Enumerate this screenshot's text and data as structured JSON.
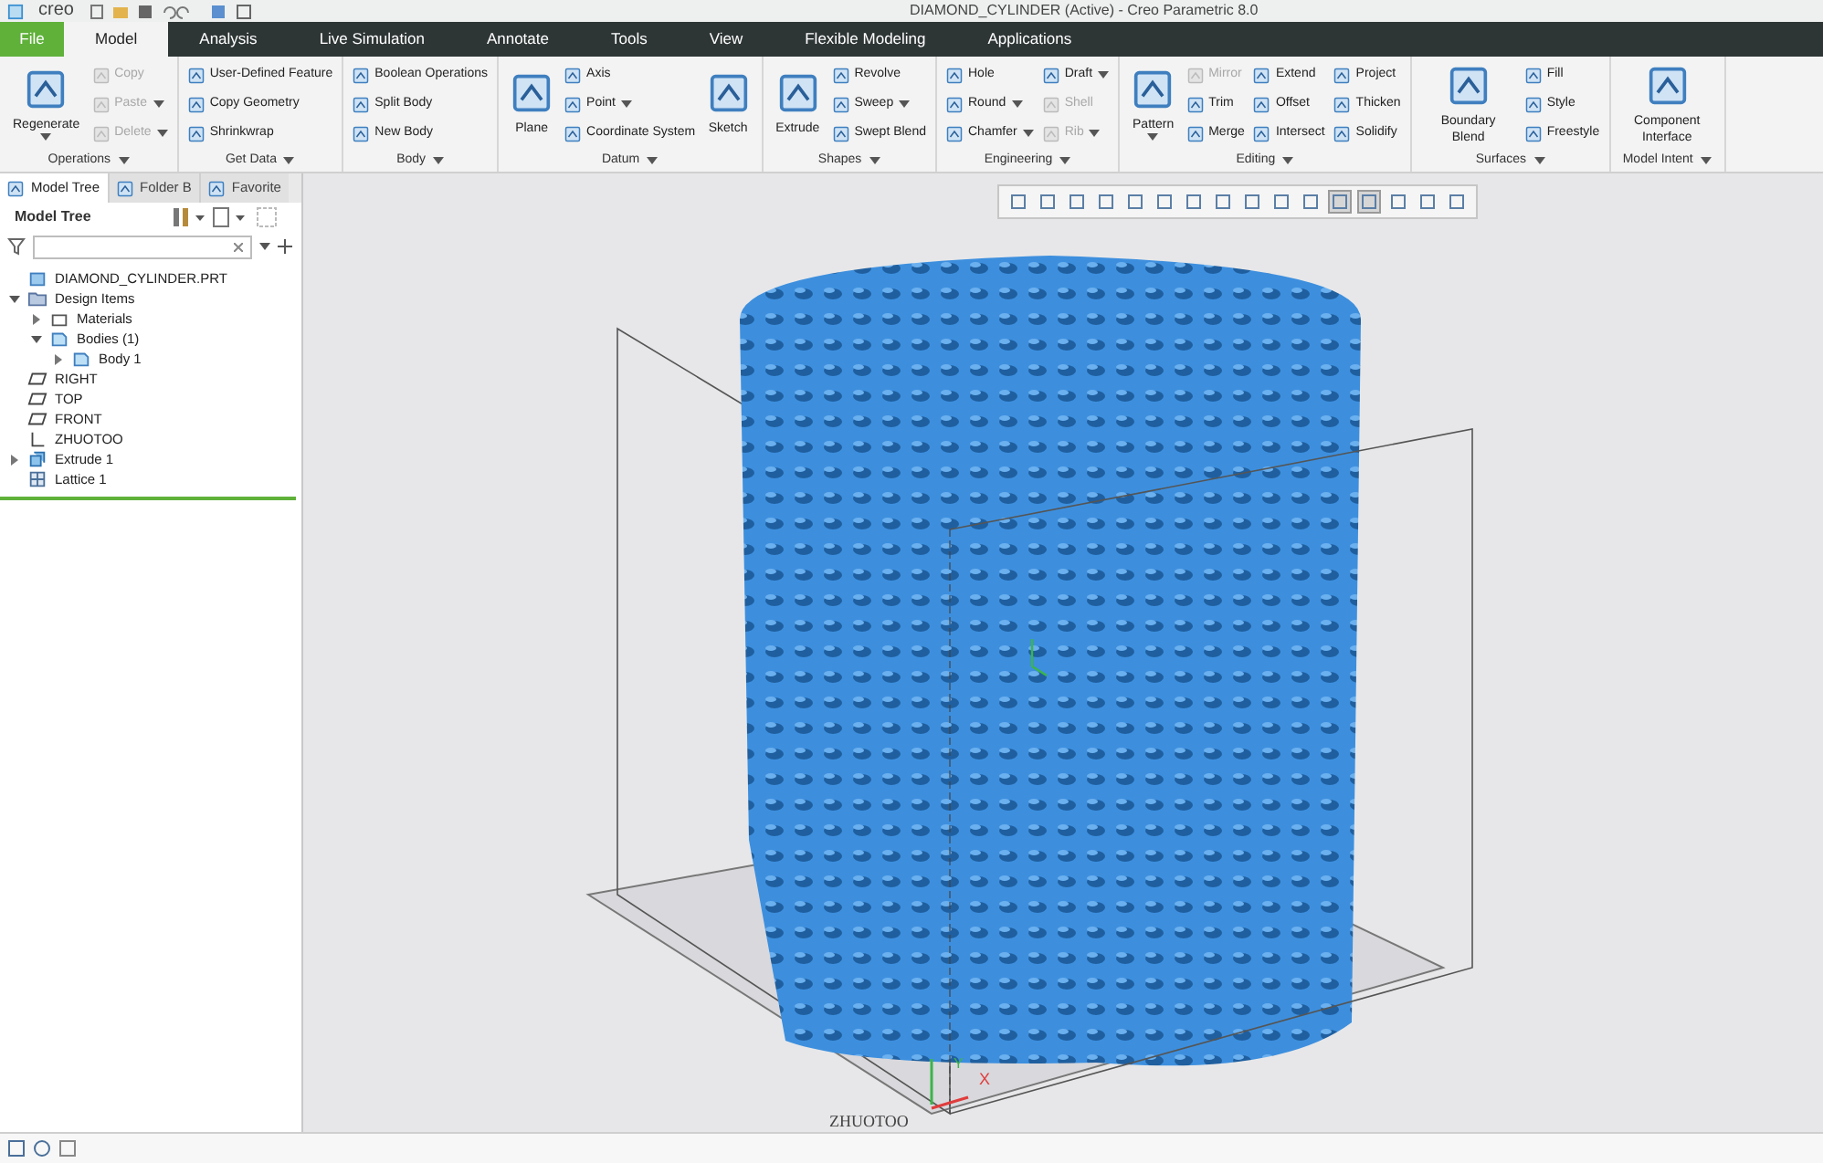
{
  "title_bar": {
    "logo": "creo",
    "title": "DIAMOND_CYLINDER (Active) - Creo Parametric 8.0"
  },
  "tabs": [
    {
      "label": "File",
      "kind": "file",
      "selected": false
    },
    {
      "label": "Model",
      "kind": "tab",
      "selected": true
    },
    {
      "label": "Analysis",
      "kind": "tab",
      "selected": false
    },
    {
      "label": "Live Simulation",
      "kind": "tab",
      "selected": false
    },
    {
      "label": "Annotate",
      "kind": "tab",
      "selected": false
    },
    {
      "label": "Tools",
      "kind": "tab",
      "selected": false
    },
    {
      "label": "View",
      "kind": "tab",
      "selected": false
    },
    {
      "label": "Flexible Modeling",
      "kind": "tab",
      "selected": false
    },
    {
      "label": "Applications",
      "kind": "tab",
      "selected": false
    }
  ],
  "ribbon_groups": [
    {
      "label": "Operations",
      "columns": [
        [
          {
            "label": "Regenerate",
            "kind": "large",
            "disabled": false,
            "dropdown": true
          }
        ],
        [
          {
            "label": "Copy",
            "kind": "small",
            "disabled": true,
            "dropdown": false
          },
          {
            "label": "Paste",
            "kind": "small",
            "disabled": true,
            "dropdown": true
          },
          {
            "label": "Delete",
            "kind": "small",
            "disabled": true,
            "dropdown": true
          }
        ]
      ]
    },
    {
      "label": "Get Data",
      "columns": [
        [
          {
            "label": "User-Defined Feature",
            "kind": "small",
            "disabled": false,
            "dropdown": false
          },
          {
            "label": "Copy Geometry",
            "kind": "small",
            "disabled": false,
            "dropdown": false
          },
          {
            "label": "Shrinkwrap",
            "kind": "small",
            "disabled": false,
            "dropdown": false
          }
        ]
      ]
    },
    {
      "label": "Body",
      "columns": [
        [
          {
            "label": "Boolean Operations",
            "kind": "small",
            "disabled": false,
            "dropdown": false
          },
          {
            "label": "Split Body",
            "kind": "small",
            "disabled": false,
            "dropdown": false
          },
          {
            "label": "New Body",
            "kind": "small",
            "disabled": false,
            "dropdown": false
          }
        ]
      ]
    },
    {
      "label": "Datum",
      "columns": [
        [
          {
            "label": "Plane",
            "kind": "large",
            "disabled": false,
            "dropdown": false
          }
        ],
        [
          {
            "label": "Axis",
            "kind": "small",
            "disabled": false,
            "dropdown": false
          },
          {
            "label": "Point",
            "kind": "small",
            "disabled": false,
            "dropdown": true
          },
          {
            "label": "Coordinate System",
            "kind": "small",
            "disabled": false,
            "dropdown": false
          }
        ],
        [
          {
            "label": "Sketch",
            "kind": "large",
            "disabled": false,
            "dropdown": false
          }
        ]
      ]
    },
    {
      "label": "Shapes",
      "columns": [
        [
          {
            "label": "Extrude",
            "kind": "large",
            "disabled": false,
            "dropdown": false
          }
        ],
        [
          {
            "label": "Revolve",
            "kind": "small",
            "disabled": false,
            "dropdown": false
          },
          {
            "label": "Sweep",
            "kind": "small",
            "disabled": false,
            "dropdown": true
          },
          {
            "label": "Swept Blend",
            "kind": "small",
            "disabled": false,
            "dropdown": false
          }
        ]
      ]
    },
    {
      "label": "Engineering",
      "columns": [
        [
          {
            "label": "Hole",
            "kind": "small",
            "disabled": false,
            "dropdown": false
          },
          {
            "label": "Round",
            "kind": "small",
            "disabled": false,
            "dropdown": true
          },
          {
            "label": "Chamfer",
            "kind": "small",
            "disabled": false,
            "dropdown": true
          }
        ],
        [
          {
            "label": "Draft",
            "kind": "small",
            "disabled": false,
            "dropdown": true
          },
          {
            "label": "Shell",
            "kind": "small",
            "disabled": true,
            "dropdown": false
          },
          {
            "label": "Rib",
            "kind": "small",
            "disabled": true,
            "dropdown": true
          }
        ]
      ]
    },
    {
      "label": "Editing",
      "columns": [
        [
          {
            "label": "Pattern",
            "kind": "large",
            "disabled": false,
            "dropdown": true
          }
        ],
        [
          {
            "label": "Mirror",
            "kind": "small",
            "disabled": true,
            "dropdown": false
          },
          {
            "label": "Trim",
            "kind": "small",
            "disabled": false,
            "dropdown": false
          },
          {
            "label": "Merge",
            "kind": "small",
            "disabled": false,
            "dropdown": false
          }
        ],
        [
          {
            "label": "Extend",
            "kind": "small",
            "disabled": false,
            "dropdown": false
          },
          {
            "label": "Offset",
            "kind": "small",
            "disabled": false,
            "dropdown": false
          },
          {
            "label": "Intersect",
            "kind": "small",
            "disabled": false,
            "dropdown": false
          }
        ],
        [
          {
            "label": "Project",
            "kind": "small",
            "disabled": false,
            "dropdown": false
          },
          {
            "label": "Thicken",
            "kind": "small",
            "disabled": false,
            "dropdown": false
          },
          {
            "label": "Solidify",
            "kind": "small",
            "disabled": false,
            "dropdown": false
          }
        ]
      ]
    },
    {
      "label": "Surfaces",
      "columns": [
        [
          {
            "label": "Boundary Blend",
            "kind": "large",
            "disabled": false,
            "dropdown": false
          }
        ],
        [
          {
            "label": "Fill",
            "kind": "small",
            "disabled": false,
            "dropdown": false
          },
          {
            "label": "Style",
            "kind": "small",
            "disabled": false,
            "dropdown": false
          },
          {
            "label": "Freestyle",
            "kind": "small",
            "disabled": false,
            "dropdown": false
          }
        ]
      ]
    },
    {
      "label": "Model Intent",
      "columns": [
        [
          {
            "label": "Component Interface",
            "kind": "large",
            "disabled": false,
            "dropdown": false
          }
        ]
      ]
    }
  ],
  "panel_tabs": [
    {
      "label": "Model Tree",
      "selected": true
    },
    {
      "label": "Folder B",
      "selected": false
    },
    {
      "label": "Favorite",
      "selected": false
    }
  ],
  "model_tree": {
    "title": "Model Tree",
    "items": [
      {
        "label": "DIAMOND_CYLINDER.PRT",
        "kind": "part"
      },
      {
        "label": "Design Items",
        "kind": "folder",
        "expanded": true,
        "children": [
          {
            "label": "Materials",
            "kind": "material",
            "expanded": false
          },
          {
            "label": "Bodies (1)",
            "kind": "body",
            "expanded": true,
            "children": [
              {
                "label": "Body 1",
                "kind": "body",
                "expanded": false
              }
            ]
          }
        ]
      },
      {
        "label": "RIGHT",
        "kind": "plane"
      },
      {
        "label": "TOP",
        "kind": "plane"
      },
      {
        "label": "FRONT",
        "kind": "plane"
      },
      {
        "label": "ZHUOTOO",
        "kind": "csys"
      },
      {
        "label": "Extrude 1",
        "kind": "feature",
        "expanded": false
      },
      {
        "label": "Lattice 1",
        "kind": "lattice"
      }
    ]
  },
  "view_toolbar": [
    {
      "selected": false
    },
    {
      "selected": false
    },
    {
      "selected": false
    },
    {
      "selected": false
    },
    {
      "selected": false
    },
    {
      "selected": false
    },
    {
      "selected": false
    },
    {
      "selected": false
    },
    {
      "selected": false
    },
    {
      "selected": false
    },
    {
      "selected": false
    },
    {
      "selected": true
    },
    {
      "selected": true
    },
    {
      "selected": false
    },
    {
      "selected": false
    },
    {
      "selected": false
    }
  ],
  "viewport": {
    "csys_label": "ZHUOTOO",
    "x_axis": "X",
    "y_axis": "Y"
  }
}
